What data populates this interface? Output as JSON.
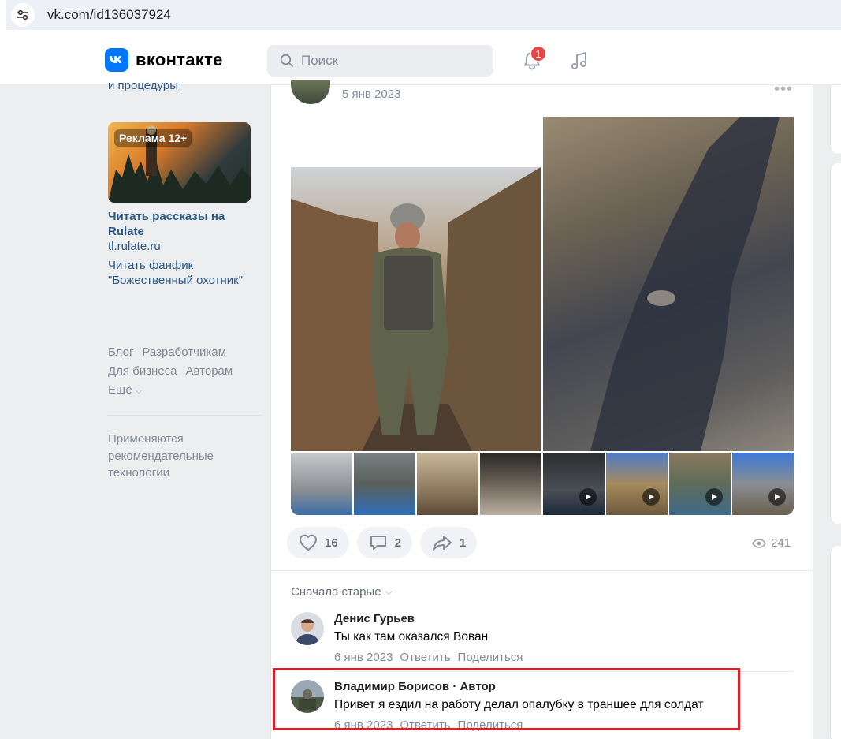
{
  "browser": {
    "url": "vk.com/id136037924"
  },
  "header": {
    "logo_text": "вконтакте",
    "search_placeholder": "Поиск",
    "notification_count": "1"
  },
  "left": {
    "procedures_link": "и процедуры",
    "ad": {
      "badge": "Реклама 12+",
      "title": "Читать рассказы на Rulate",
      "domain": "tl.rulate.ru",
      "description": "Читать фанфик \"Божественный охотник\""
    },
    "footer_links": {
      "blog": "Блог",
      "developers": "Разработчикам",
      "business": "Для бизнеса",
      "authors": "Авторам",
      "more": "Ещё"
    },
    "recommendation_note": "Применяются рекомендательные технологии"
  },
  "post": {
    "date": "5 янв 2023",
    "likes": "16",
    "comments": "2",
    "shares": "1",
    "views": "241"
  },
  "comments_section": {
    "sort_label": "Сначала старые",
    "reply_label": "Ответить",
    "share_label": "Поделиться",
    "items": [
      {
        "name": "Денис Гурьев",
        "text": "Ты как там оказался Вован",
        "date": "6 янв 2023"
      },
      {
        "name": "Владимир Борисов · Автор",
        "text": "Привет я ездил на работу делал опалубку в траншее для солдат",
        "date": "6 янв 2023"
      }
    ]
  },
  "colors": {
    "brand": "#0077ff",
    "link": "#2a5885",
    "muted": "#818c99",
    "badge": "#e64646",
    "highlight": "#d9202a"
  }
}
